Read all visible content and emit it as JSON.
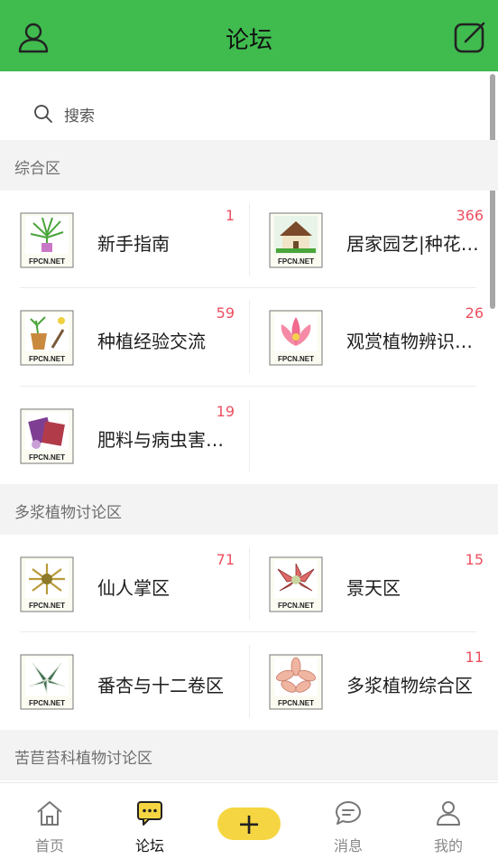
{
  "header": {
    "title": "论坛",
    "user_icon": "user-icon",
    "edit_icon": "edit-icon"
  },
  "search": {
    "placeholder": "搜索"
  },
  "sections": [
    {
      "title": "综合区",
      "items": [
        {
          "name": "新手指南",
          "count": "1",
          "thumb": "spider-plant"
        },
        {
          "name": "居家园艺|种花…",
          "count": "366",
          "thumb": "house"
        },
        {
          "name": "种植经验交流",
          "count": "59",
          "thumb": "pot-trowel"
        },
        {
          "name": "观赏植物辨识…",
          "count": "26",
          "thumb": "lotus"
        },
        {
          "name": "肥料与病虫害…",
          "count": "19",
          "thumb": "bags"
        }
      ]
    },
    {
      "title": "多浆植物讨论区",
      "items": [
        {
          "name": "仙人掌区",
          "count": "71",
          "thumb": "cactus"
        },
        {
          "name": "景天区",
          "count": "15",
          "thumb": "succulent-red"
        },
        {
          "name": "番杏与十二卷区",
          "count": "",
          "thumb": "haworthia"
        },
        {
          "name": "多浆植物综合区",
          "count": "11",
          "thumb": "succulent-pink"
        }
      ]
    },
    {
      "title": "苦苣苔科植物讨论区",
      "items": []
    }
  ],
  "thumb_caption": "FPCN.NET",
  "tabbar": {
    "tabs": [
      {
        "label": "首页",
        "icon": "home-icon"
      },
      {
        "label": "论坛",
        "icon": "forum-icon"
      },
      {
        "label": "消息",
        "icon": "message-icon"
      },
      {
        "label": "我的",
        "icon": "profile-icon"
      }
    ],
    "plus": "+"
  },
  "colors": {
    "header": "#40bb4e",
    "count": "#ec4f5f",
    "plus_button": "#f5d642"
  }
}
